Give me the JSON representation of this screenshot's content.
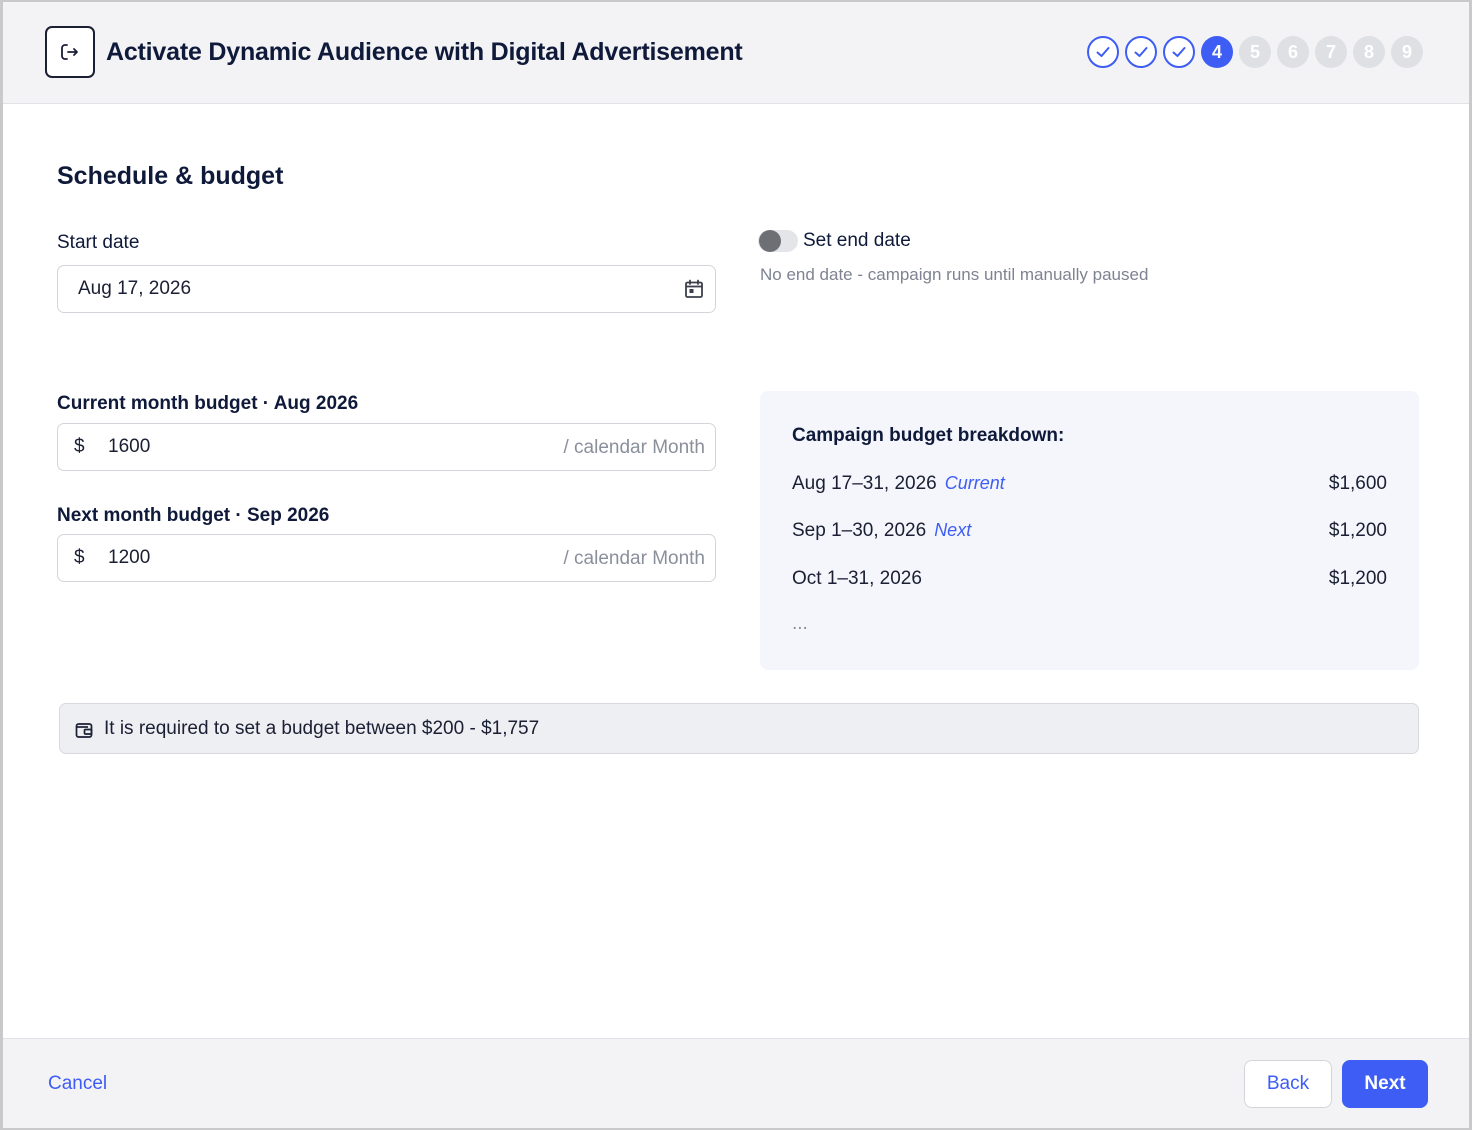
{
  "header": {
    "title": "Activate Dynamic Audience with Digital Advertisement",
    "exit_icon": "exit-arrow-icon",
    "steps": [
      {
        "label": "",
        "state": "done"
      },
      {
        "label": "",
        "state": "done"
      },
      {
        "label": "",
        "state": "done"
      },
      {
        "label": "4",
        "state": "active"
      },
      {
        "label": "5",
        "state": "todo"
      },
      {
        "label": "6",
        "state": "todo"
      },
      {
        "label": "7",
        "state": "todo"
      },
      {
        "label": "8",
        "state": "todo"
      },
      {
        "label": "9",
        "state": "todo"
      }
    ]
  },
  "schedule": {
    "section_title": "Schedule & budget",
    "start_date_label": "Start date",
    "start_date_value": "Aug 17, 2026",
    "end_date_toggle_label": "Set end date",
    "end_date_toggle_on": false,
    "end_date_help": "No end date - campaign runs until manually paused"
  },
  "budget": {
    "current_label": "Current month budget · Aug 2026",
    "current_prefix": "$",
    "current_value": "1600",
    "current_suffix": "/ calendar Month",
    "next_label": "Next month budget · Sep 2026",
    "next_prefix": "$",
    "next_value": "1200",
    "next_suffix": "/ calendar Month"
  },
  "breakdown": {
    "title": "Campaign budget breakdown:",
    "rows": [
      {
        "period": "Aug 17–31, 2026",
        "tag": "Current",
        "amount": "$1,600"
      },
      {
        "period": "Sep 1–30, 2026",
        "tag": "Next",
        "amount": "$1,200"
      },
      {
        "period": "Oct 1–31, 2026",
        "tag": "",
        "amount": "$1,200"
      }
    ],
    "more": "..."
  },
  "notice": {
    "text": "It is required to set a budget between $200 - $1,757",
    "icon": "wallet-icon"
  },
  "footer": {
    "cancel_label": "Cancel",
    "back_label": "Back",
    "next_label": "Next"
  },
  "colors": {
    "accent": "#3d5df4",
    "step_todo": "#dfe0e4"
  }
}
